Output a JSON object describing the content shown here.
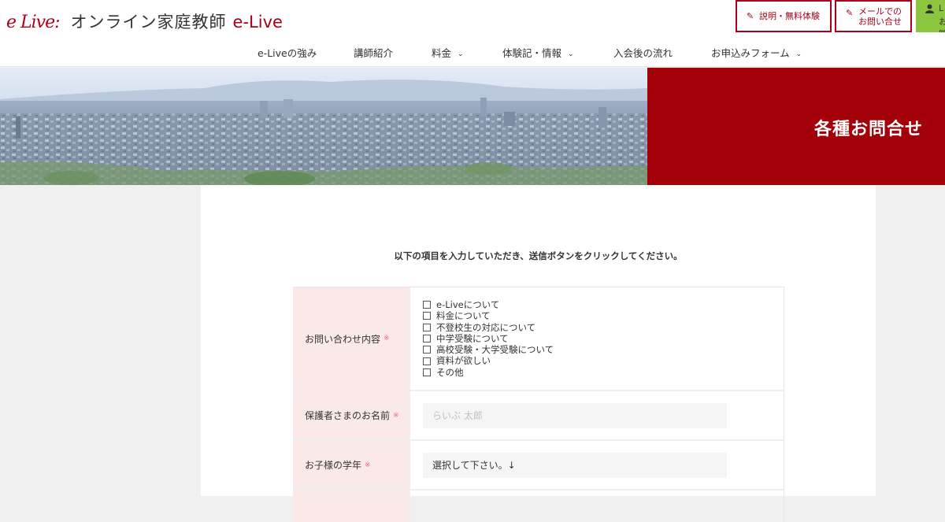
{
  "header": {
    "logo_mark": "e Live:",
    "logo_text": "オンライン家庭教師",
    "logo_brand": "e-Live",
    "button_trial": "説明・無料体験",
    "button_mail_line1": "メールでの",
    "button_mail_line2": "お問い合せ",
    "button_line_partial_1": "L",
    "button_line_partial_2": "お問"
  },
  "nav": {
    "items": [
      "e-Liveの強み",
      "講師紹介",
      "料金",
      "体験記・情報",
      "入会後の流れ",
      "お申込みフォーム"
    ]
  },
  "hero": {
    "title": "各種お問合せ"
  },
  "main": {
    "intro": "以下の項目を入力していただき、送信ボタンをクリックしてください。"
  },
  "form": {
    "required_mark": "※",
    "inquiry_label": "お問い合わせ内容",
    "inquiry_options": [
      "e-Liveについて",
      "料金について",
      "不登校生の対応について",
      "中学受験について",
      "高校受験・大学受験について",
      "資料が欲しい",
      "その他"
    ],
    "guardian_label": "保護者さまのお名前",
    "guardian_placeholder": "らいぶ 太郎",
    "grade_label": "お子様の学年",
    "grade_value": "選択して下さい。↓"
  },
  "colors": {
    "brand_red": "#a3000a",
    "label_pink": "#fbe8e8",
    "line_green": "#8cc63f"
  }
}
